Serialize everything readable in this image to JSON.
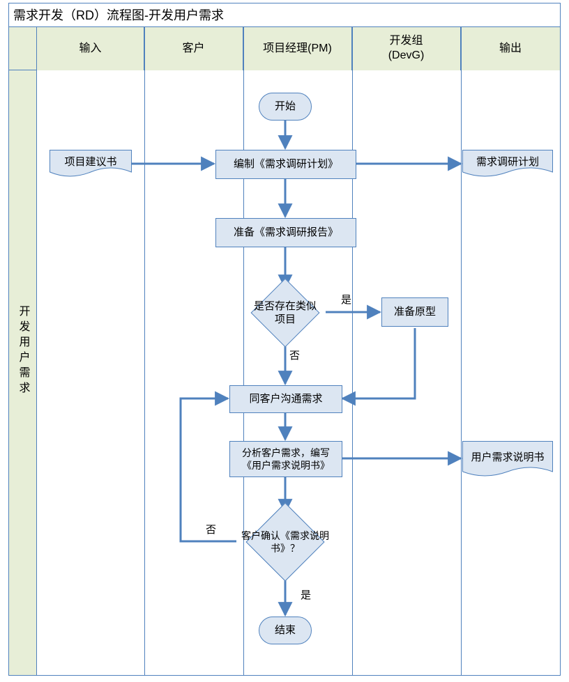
{
  "title": "需求开发（RD）流程图-开发用户需求",
  "lanes": {
    "vertical_label": "开发用户需求",
    "headers": {
      "input": "输入",
      "customer": "客户",
      "pm": "项目经理(PM)",
      "devg_line1": "开发组",
      "devg_line2": "(DevG)",
      "output": "输出"
    }
  },
  "nodes": {
    "start": "开始",
    "doc_input": "项目建议书",
    "p_plan": "编制《需求调研计划》",
    "out_plan": "需求调研计划",
    "p_report": "准备《需求调研报告》",
    "d_similar": "是否存在类似项目",
    "p_prototype": "准备原型",
    "p_communicate": "同客户沟通需求",
    "p_analyze": "分析客户需求，编写《用户需求说明书》",
    "out_spec": "用户需求说明书",
    "d_confirm": "客户确认《需求说明书》？",
    "end": "结束"
  },
  "edge_labels": {
    "yes1": "是",
    "no1": "否",
    "no2": "否",
    "yes2": "是"
  }
}
